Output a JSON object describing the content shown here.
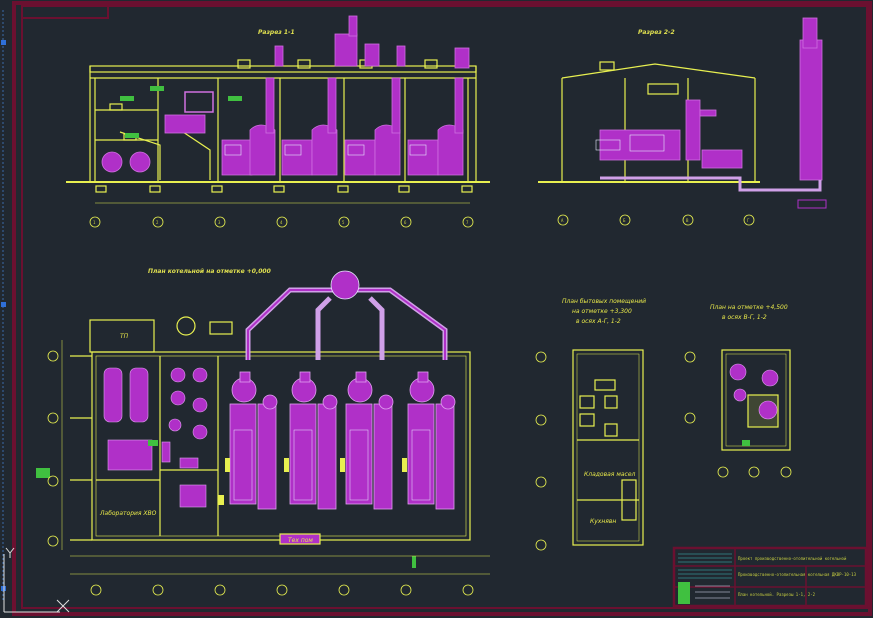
{
  "drawing": {
    "section_1_1": "Разрез 1-1",
    "section_2_2": "Разрез 2-2",
    "plan_main": "План котельной на отметке +0,000",
    "plan_aux": "План бытовых помещений на отметке +3,300 в осях А-Г, 1-2",
    "plan_aux_line1": "План бытовых помещений",
    "plan_aux_line2": "на отметке +3,300",
    "plan_aux_line3": "в осях А-Г, 1-2",
    "plan_stack_line1": "План на отметке +4,500",
    "plan_stack_line2": "в осях В-Г, 1-2",
    "room_tp": "ТП",
    "room_lab": "Лаборатория ХВО",
    "room_tech": "Тех пом",
    "room_storage": "Кладовая масел",
    "room_kitchen": "Кухнявн",
    "axes_numbers": [
      "1",
      "2",
      "3",
      "4",
      "5",
      "6",
      "7"
    ],
    "axes_letters": [
      "А",
      "Б",
      "В",
      "Г"
    ]
  },
  "title_block": {
    "line1": "Проект производственно-отопительной котельной",
    "line2": "Производственно-отопительная котельная ДКВР-10-13",
    "line3": "План котельной. Разрезы 1-1, 2-2"
  },
  "colors": {
    "background": "#212830",
    "frame": "#6b1030",
    "structure": "#e8f050",
    "equipment": "#b030c8",
    "duct": "#d0a0e8",
    "dimension": "#40c040"
  }
}
